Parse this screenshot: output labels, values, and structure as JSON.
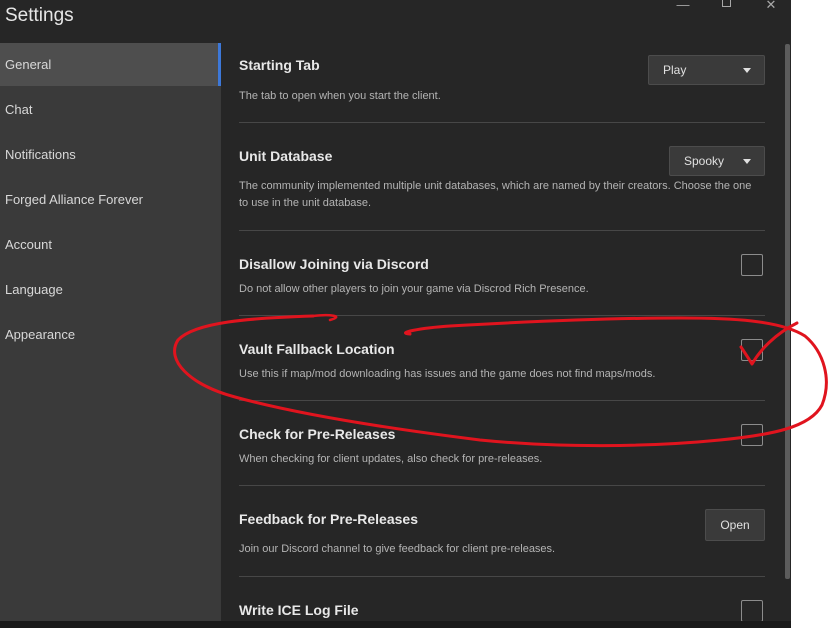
{
  "window": {
    "title": "Settings",
    "controls": {
      "minimize": "—",
      "maximize": "",
      "close": "✕"
    }
  },
  "sidebar": {
    "items": [
      {
        "label": "General",
        "active": true
      },
      {
        "label": "Chat"
      },
      {
        "label": "Notifications"
      },
      {
        "label": "Forged Alliance Forever"
      },
      {
        "label": "Account"
      },
      {
        "label": "Language"
      },
      {
        "label": "Appearance"
      }
    ]
  },
  "settings": {
    "starting_tab": {
      "title": "Starting Tab",
      "desc": "The tab to open when you start the client.",
      "value": "Play"
    },
    "unit_database": {
      "title": "Unit Database",
      "desc": "The community implemented multiple unit databases, which are named by their creators. Choose the one to use in the unit database.",
      "value": "Spooky"
    },
    "disallow_discord": {
      "title": "Disallow Joining via Discord",
      "desc": "Do not allow other players to join your game via Discrod Rich Presence.",
      "checked": false
    },
    "vault_fallback": {
      "title": "Vault Fallback Location",
      "desc": "Use this if map/mod downloading has issues and the game does not find maps/mods.",
      "checked": false
    },
    "pre_releases": {
      "title": "Check for Pre-Releases",
      "desc": "When checking for client updates, also check for pre-releases.",
      "checked": false
    },
    "feedback": {
      "title": "Feedback for Pre-Releases",
      "desc": "Join our Discord channel to give feedback for client pre-releases.",
      "button_label": "Open"
    },
    "ice_log": {
      "title": "Write ICE Log File",
      "checked": false
    }
  },
  "colors": {
    "background": "#262626",
    "sidebar": "#3a3a3a",
    "accent": "#3d78d8",
    "annotation": "#e0141e"
  }
}
